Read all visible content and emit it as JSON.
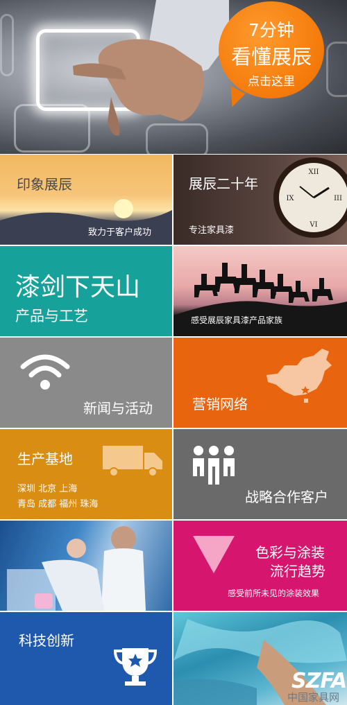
{
  "hero": {
    "bubble": {
      "line1": "7分钟",
      "line2": "看懂展辰",
      "line3": "点击这里"
    }
  },
  "tiles": {
    "impression": {
      "title": "印象展辰",
      "subtitle": "致力于客户成功"
    },
    "twenty_years": {
      "title": "展辰二十年",
      "subtitle": "专注家具漆"
    },
    "products": {
      "title": "漆剑下天山",
      "subtitle": "产品与工艺"
    },
    "family": {
      "caption": "感受展辰家具漆产品家族"
    },
    "news": {
      "title": "新闻与活动"
    },
    "network": {
      "title": "营销网络"
    },
    "production": {
      "title": "生产基地",
      "cities_line1": "深圳 北京 上海",
      "cities_line2": "青岛 成都 福州 珠海"
    },
    "partners": {
      "title": "战略合作客户"
    },
    "color": {
      "title_line1": "色彩与涂装",
      "title_line2": "流行趋势",
      "subtitle": "感受前所未见的涂装效果"
    },
    "tech": {
      "title": "科技创新"
    },
    "watermark": {
      "logo": "SZFA",
      "site": "中国家具网"
    }
  },
  "colors": {
    "teal": "#17a19b",
    "orange": "#e9640f",
    "gray": "#8a8a8a",
    "darkgray": "#6a6a6a",
    "gold": "#d98d12",
    "magenta": "#d6156f",
    "blue": "#1e59ad"
  }
}
